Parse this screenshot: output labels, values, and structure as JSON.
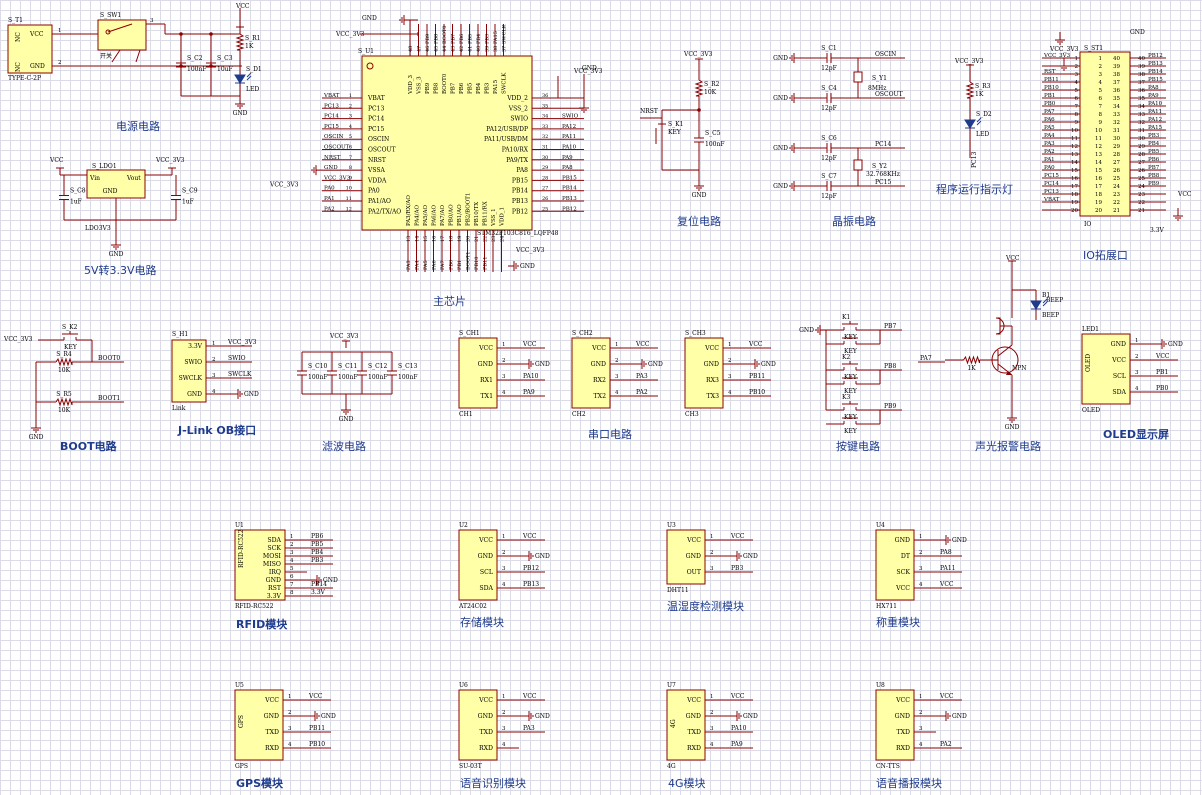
{
  "sections": {
    "power": "电源电路",
    "ldo": "5V转3.3V电路",
    "mcu": "主芯片",
    "reset": "复位电路",
    "crystal": "晶振电路",
    "led": "程序运行指示灯",
    "io": "IO拓展口",
    "boot": "BOOT电路",
    "jlink": "J-Link OB接口",
    "filter": "滤波电路",
    "uart": "串口电路",
    "keys": "按键电路",
    "alarm": "声光报警电路",
    "oled": "OLED显示屏",
    "rfid": "RFID模块",
    "storage": "存储模块",
    "dht": "温湿度检测模块",
    "weigh": "称重模块",
    "gps": "GPS模块",
    "voice_rec": "语音识别模块",
    "g4": "4G模块",
    "tts": "语音播报模块"
  },
  "power": {
    "t1": "S_T1",
    "t1_type": "TYPE-C-2P",
    "t1_vcc": "VCC",
    "t1_gnd": "GND",
    "t1_nc": "NC",
    "sw1": "S_SW1",
    "sw1_label": "开关",
    "c2": "S_C2",
    "c2v": "100nF",
    "c3": "S_C3",
    "c3v": "10uF",
    "r1": "S_R1",
    "r1v": "1K",
    "d1": "S_D1",
    "d1v": "LED",
    "vcc": "VCC",
    "gnd": "GND"
  },
  "ldo": {
    "name": "S_LDO1",
    "part": "LDO3V3",
    "vin": "Vin",
    "vout": "Vout",
    "gnd": "GND",
    "c8": "S_C8",
    "c8v": "1uF",
    "c9": "S_C9",
    "c9v": "1uF",
    "vcc": "VCC",
    "vcc33": "VCC_3V3"
  },
  "mcu": {
    "ref": "S_U1",
    "part": "STM32F103C8T6_LQFP48",
    "gnd": "GND",
    "vcc33": "VCC_3V3",
    "top_labels": [
      "VDD_3",
      "VSS_3",
      "PB9",
      "PB8",
      "BOOT0",
      "PB7",
      "PB6",
      "PB5",
      "PB4",
      "PB3",
      "PA15",
      "SWCLK"
    ],
    "top_nets": [
      "PB9",
      "PB8",
      "BOOT0",
      "PB7",
      "PB6",
      "PB5",
      "PB4",
      "PB3",
      "PA15",
      "SWCLK"
    ],
    "top_pins": [
      "48",
      "47",
      "46",
      "45",
      "44",
      "43",
      "42",
      "41",
      "40",
      "39",
      "38",
      "37"
    ],
    "left_labels": [
      "VBAT",
      "PC13",
      "PC14",
      "PC15",
      "OSCIN",
      "OSCOUT",
      "NRST",
      "VSSA",
      "VDDA",
      "PA0",
      "PA1/AO",
      "PA2/TX/AO"
    ],
    "left_pins": [
      "1",
      "2",
      "3",
      "4",
      "5",
      "6",
      "7",
      "8",
      "9",
      "10",
      "11",
      "12"
    ],
    "left_nets": [
      "VBAT",
      "PC13",
      "PC14",
      "PC15",
      "OSCIN",
      "OSCOUT",
      "NRST",
      "GND",
      "VCC_3V3",
      "PA0",
      "PA1",
      "PA2"
    ],
    "right_labels": [
      "VDD_2",
      "VSS_2",
      "SWIO",
      "PA12/USB/DP",
      "PA11/USB/DM",
      "PA10/RX",
      "PA9/TX",
      "PA8",
      "PB15",
      "PB14",
      "PB13",
      "PB12"
    ],
    "right_pins": [
      "36",
      "35",
      "34",
      "33",
      "32",
      "31",
      "30",
      "29",
      "28",
      "27",
      "26",
      "25"
    ],
    "right_nets": [
      "",
      "",
      "SWIO",
      "PA12",
      "PA11",
      "PA10",
      "PA9",
      "PA8",
      "PB15",
      "PB14",
      "PB13",
      "PB12"
    ],
    "bottom_labels": [
      "PA3/RX/AO",
      "PA4/AO",
      "PA5/AO",
      "PA6/AO",
      "PA7/AO",
      "PB0/AO",
      "PB1/AO",
      "PB2/BOOT1",
      "PB10/TX",
      "PB11/RX",
      "VSS_1",
      "VDD_1"
    ],
    "bottom_pins": [
      "13",
      "14",
      "15",
      "16",
      "17",
      "18",
      "19",
      "20",
      "21",
      "22",
      "23",
      "24"
    ],
    "bottom_nets": [
      "PA3",
      "PA4",
      "PA5",
      "PA6",
      "PA7",
      "PB0",
      "PB1",
      "BOOT1",
      "PB10",
      "PB11"
    ]
  },
  "reset": {
    "vcc33": "VCC_3V3",
    "r2": "S_R2",
    "r2v": "10K",
    "k1": "S_K1",
    "k1v": "KEY",
    "c5": "S_C5",
    "c5v": "100nF",
    "nrst": "NRST",
    "gnd": "GND"
  },
  "crystal": {
    "c1": "S_C1",
    "c4": "S_C4",
    "c6": "S_C6",
    "c7": "S_C7",
    "cv": "12pF",
    "y1": "S_Y1",
    "y1v": "8MHz",
    "y2": "S_Y2",
    "y2v": "32.768KHz",
    "oscin": "OSCIN",
    "oscout": "OSCOUT",
    "pc14": "PC14",
    "pc15": "PC15",
    "gnd": "GND"
  },
  "led": {
    "vcc33": "VCC_3V3",
    "r3": "S_R3",
    "r3v": "1K",
    "d2": "S_D2",
    "d2v": "LED",
    "net": "PC13"
  },
  "io": {
    "ref": "S_ST1",
    "part": "IO",
    "gnd": "GND",
    "vcc33": "VCC_3V3",
    "vcc": "VCC",
    "v33": "3.3V",
    "left_nets": [
      "VCC_3V3",
      "",
      "RST",
      "PB11",
      "PB10",
      "PB1",
      "PB0",
      "PA7",
      "PA6",
      "PA5",
      "PA4",
      "PA3",
      "PA2",
      "PA1",
      "PA0",
      "PC15",
      "PC14",
      "PC13",
      "VBAT",
      ""
    ],
    "left_pins": [
      "1",
      "2",
      "3",
      "4",
      "5",
      "6",
      "7",
      "8",
      "9",
      "10",
      "11",
      "12",
      "13",
      "14",
      "15",
      "16",
      "17",
      "18",
      "19",
      "20"
    ],
    "right_pins": [
      "40",
      "39",
      "38",
      "37",
      "36",
      "35",
      "34",
      "33",
      "32",
      "31",
      "30",
      "29",
      "28",
      "27",
      "26",
      "25",
      "24",
      "23",
      "22",
      "21"
    ],
    "right_nets": [
      "PB12",
      "PB13",
      "PB14",
      "PB15",
      "PA8",
      "PA9",
      "PA10",
      "PA11",
      "PA12",
      "PA15",
      "PB3",
      "PB4",
      "PB5",
      "PB6",
      "PB7",
      "PB8",
      "PB9",
      "",
      "",
      ""
    ]
  },
  "boot": {
    "vcc33": "VCC_3V3",
    "k2": "S_K2",
    "k2v": "KEY",
    "r4": "S_R4",
    "r4v": "10K",
    "r5": "S_R5",
    "r5v": "10K",
    "boot0": "BOOT0",
    "boot1": "BOOT1",
    "gnd": "GND"
  },
  "jlink": {
    "ref": "S_H1",
    "part": "Link",
    "pins": [
      "3.3V",
      "SWIO",
      "SWCLK",
      "GND"
    ],
    "nums": [
      "1",
      "2",
      "3",
      "4"
    ],
    "nets": [
      "VCC_3V3",
      "SWIO",
      "SWCLK",
      "GND"
    ]
  },
  "filter": {
    "vcc33": "VCC_3V3",
    "caps": [
      "S_C10",
      "S_C11",
      "S_C12",
      "S_C13"
    ],
    "cv": "100nF",
    "gnd": "GND"
  },
  "uart": [
    {
      "ref": "S_CH1",
      "part": "CH1",
      "pins": [
        "VCC",
        "GND",
        "RX1",
        "TX1"
      ],
      "nets": [
        "VCC",
        "GND",
        "PA10",
        "PA9"
      ]
    },
    {
      "ref": "S_CH2",
      "part": "CH2",
      "pins": [
        "VCC",
        "GND",
        "RX2",
        "TX2"
      ],
      "nets": [
        "VCC",
        "GND",
        "PA3",
        "PA2"
      ]
    },
    {
      "ref": "S_CH3",
      "part": "CH3",
      "pins": [
        "VCC",
        "GND",
        "RX3",
        "TX3"
      ],
      "nets": [
        "VCC",
        "GND",
        "PB11",
        "PB10"
      ]
    }
  ],
  "keys": {
    "gnd": "GND",
    "k": [
      "K1",
      "K2",
      "K3"
    ],
    "kv": "KEY",
    "nets": [
      "PB7",
      "PB8",
      "PB9"
    ]
  },
  "alarm": {
    "vcc": "VCC",
    "b1": "B1",
    "b1v": "BEEP",
    "r": "1K",
    "net": "PA7",
    "q": "NPN",
    "gnd": "GND"
  },
  "oled": {
    "ref": "LED1",
    "part": "OLED",
    "body": "OLED",
    "pins": [
      "GND",
      "VCC",
      "SCL",
      "SDA"
    ],
    "nets": [
      "GND",
      "VCC",
      "PB1",
      "PB0"
    ]
  },
  "rfid": {
    "ref": "U1",
    "part": "RFID-RC522",
    "body": "RFID-RC522",
    "pins": [
      "SDA",
      "SCK",
      "MOSI",
      "MISO",
      "IRQ",
      "GND",
      "RST",
      "3.3V"
    ],
    "nets": [
      "PB6",
      "PB5",
      "PB4",
      "PB3",
      "",
      "GND",
      "PB14",
      "3.3V"
    ]
  },
  "at24": {
    "ref": "U2",
    "part": "AT24C02",
    "pins": [
      "VCC",
      "GND",
      "SCL",
      "SDA"
    ],
    "nets": [
      "VCC",
      "GND",
      "PB12",
      "PB13"
    ]
  },
  "dht": {
    "ref": "U3",
    "part": "DHT11",
    "pins": [
      "VCC",
      "GND",
      "OUT"
    ],
    "nets": [
      "VCC",
      "GND",
      "PB3"
    ]
  },
  "hx": {
    "ref": "U4",
    "part": "HX711",
    "pins": [
      "GND",
      "DT",
      "SCK",
      "VCC"
    ],
    "nets": [
      "GND",
      "PA8",
      "PA11",
      "VCC"
    ]
  },
  "gps": {
    "ref": "U5",
    "part": "GPS",
    "body": "GPS",
    "pins": [
      "VCC",
      "GND",
      "TXD",
      "RXD"
    ],
    "nets": [
      "VCC",
      "GND",
      "PB11",
      "PB10"
    ]
  },
  "su03t": {
    "ref": "U6",
    "part": "SU-03T",
    "pins": [
      "VCC",
      "GND",
      "TXD",
      "RXD"
    ],
    "nets": [
      "VCC",
      "GND",
      "PA3",
      ""
    ]
  },
  "g4": {
    "ref": "U7",
    "part": "4G",
    "body": "4G",
    "pins": [
      "VCC",
      "GND",
      "TXD",
      "RXD"
    ],
    "nets": [
      "VCC",
      "GND",
      "PA10",
      "PA9"
    ]
  },
  "tts": {
    "ref": "U8",
    "part": "CN-TTS",
    "pins": [
      "VCC",
      "GND",
      "TXD",
      "RXD"
    ],
    "nets": [
      "VCC",
      "GND",
      "",
      "PA2"
    ]
  }
}
